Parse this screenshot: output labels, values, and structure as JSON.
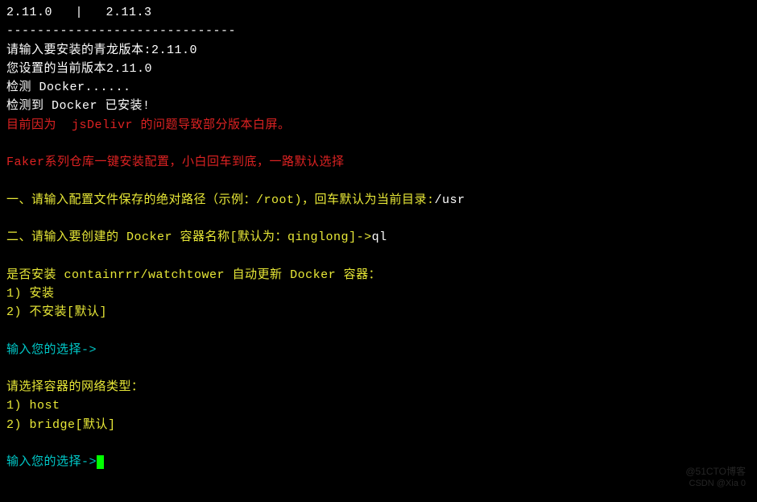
{
  "lines": {
    "l1": "2.11.0   |   2.11.3",
    "l2": "------------------------------",
    "l3a": "请输入要安装的青龙版本:",
    "l3b": "2.11.0",
    "l4a": "您设置的当前版本",
    "l4b": "2.11.0",
    "l5": "检测 Docker......",
    "l6": "检测到 Docker 已安装!",
    "l7a": "目前因为  ",
    "l7b": "jsDelivr",
    "l7c": " 的问题导致部分版本白屏。",
    "l8a": "Faker",
    "l8b": "系列仓库一键安装配置，小白回车到底，一路默认选择",
    "l9a": "一、请输入配置文件保存的绝对路径（示例：",
    "l9b": "/root",
    "l9c": ")，回车默认为当前目录:",
    "l9d": "/usr",
    "l10a": "二、请输入要创建的 ",
    "l10b": "Docker",
    "l10c": " 容器名称[默认为：",
    "l10d": "qinglong",
    "l10e": "]->",
    "l10f": "ql",
    "l11a": "是否安装 ",
    "l11b": "containrrr/watchtower",
    "l11c": " 自动更新 ",
    "l11d": "Docker",
    "l11e": " 容器：",
    "l12": "1) 安装",
    "l13": "2) 不安装[默认]",
    "l14": "输入您的选择->",
    "l15": "请选择容器的网络类型：",
    "l16": "1) host",
    "l17": "2) bridge[默认]",
    "l18": "输入您的选择->"
  },
  "watermark1": "@51CTO博客",
  "watermark2": "CSDN @Xia 0"
}
